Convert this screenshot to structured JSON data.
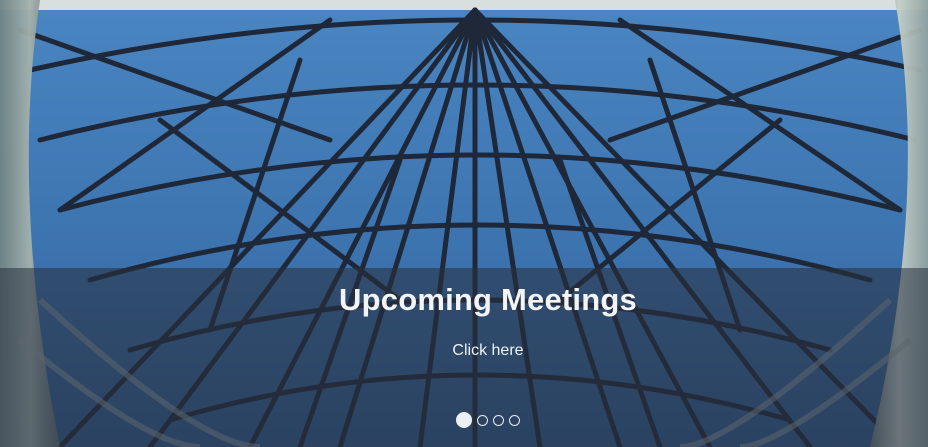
{
  "slider": {
    "title": "Upcoming Meetings",
    "link_text": "Click here",
    "slide_count": 4,
    "active_index": 0,
    "colors": {
      "sky": "#3d78b6",
      "frame": "#1f2a3a",
      "overlay": "#28303e",
      "text": "#f2f4f6"
    }
  }
}
